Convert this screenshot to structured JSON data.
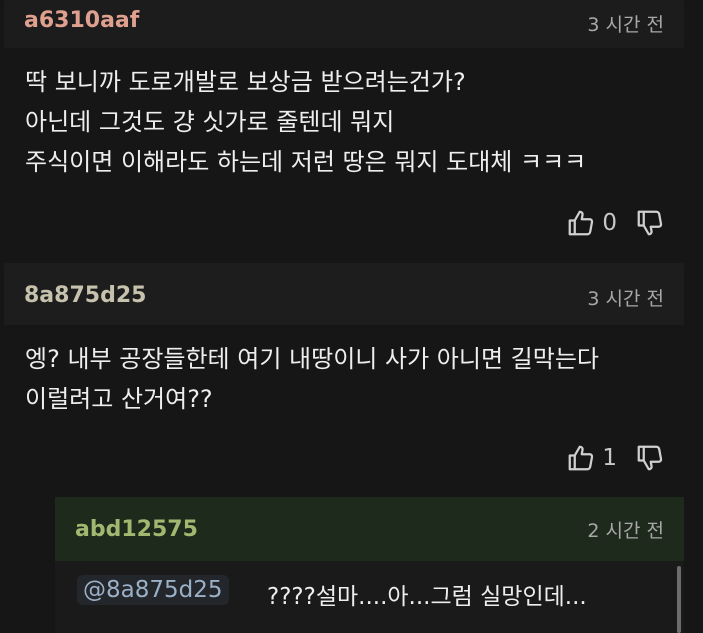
{
  "comments": [
    {
      "author": "a6310aaf",
      "author_color": "#e0a08f",
      "time": "3 시간 전",
      "lines": [
        "딱 보니까 도로개발로 보상금 받으려는건가?",
        "아닌데 그것도 걍 싯가로 줄텐데 뭐지",
        "주식이면 이해라도 하는데 저런 땅은 뭐지 도대체 ㅋㅋㅋ"
      ],
      "likes": "0"
    },
    {
      "author": "8a875d25",
      "author_color": "#c7c2ad",
      "time": "3 시간 전",
      "lines": [
        "엥? 내부 공장들한테 여기 내땅이니 사가 아니면 길막는다",
        "이럴려고 산거여??"
      ],
      "likes": "1"
    }
  ],
  "reply": {
    "author": "abd12575",
    "author_color": "#a0b870",
    "time": "2 시간 전",
    "mention": "@8a875d25",
    "text": "????설마....아...그럼 실망인데..."
  }
}
